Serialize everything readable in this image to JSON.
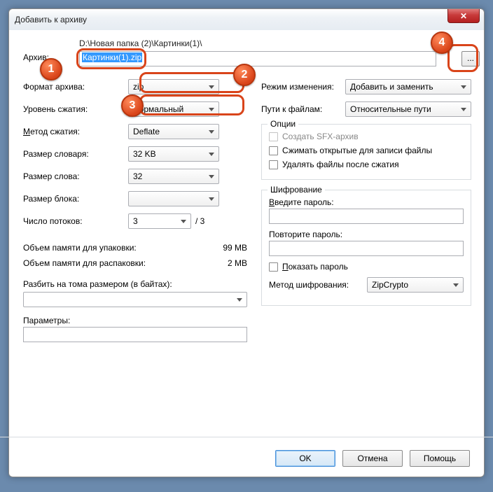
{
  "window": {
    "title": "Добавить к архиву"
  },
  "archive": {
    "label": "Архив:",
    "path": "D:\\Новая папка (2)\\Картинки(1)\\",
    "filename": "Картинки(1).zip",
    "browse": "..."
  },
  "left": {
    "format": {
      "label": "Формат архива:",
      "value": "zip"
    },
    "level": {
      "label": "Уровень сжатия:",
      "value": "Нормальный"
    },
    "method": {
      "label": "Метод сжатия:",
      "value": "Deflate"
    },
    "dict": {
      "label": "Размер словаря:",
      "value": "32 KB"
    },
    "word": {
      "label": "Размер слова:",
      "value": "32"
    },
    "block": {
      "label": "Размер блока:",
      "value": ""
    },
    "threads": {
      "label": "Число потоков:",
      "value": "3",
      "max": "/ 3"
    },
    "mem_pack": {
      "label": "Объем памяти для упаковки:",
      "value": "99 MB"
    },
    "mem_unpack": {
      "label": "Объем памяти для распаковки:",
      "value": "2 MB"
    },
    "split": {
      "label": "Разбить на тома размером (в байтах):"
    },
    "params": {
      "label": "Параметры:"
    }
  },
  "right": {
    "mode": {
      "label": "Режим изменения:",
      "value": "Добавить и заменить"
    },
    "paths": {
      "label": "Пути к файлам:",
      "value": "Относительные пути"
    },
    "options": {
      "title": "Опции",
      "sfx": "Создать SFX-архив",
      "shared": "Сжимать открытые для записи файлы",
      "delete": "Удалять файлы после сжатия"
    },
    "encrypt": {
      "title": "Шифрование",
      "pwd": "Введите пароль:",
      "pwd2": "Повторите пароль:",
      "show": "Показать пароль",
      "method_label": "Метод шифрования:",
      "method_value": "ZipCrypto"
    }
  },
  "buttons": {
    "ok": "OK",
    "cancel": "Отмена",
    "help": "Помощь"
  },
  "markers": {
    "m1": "1",
    "m2": "2",
    "m3": "3",
    "m4": "4"
  }
}
